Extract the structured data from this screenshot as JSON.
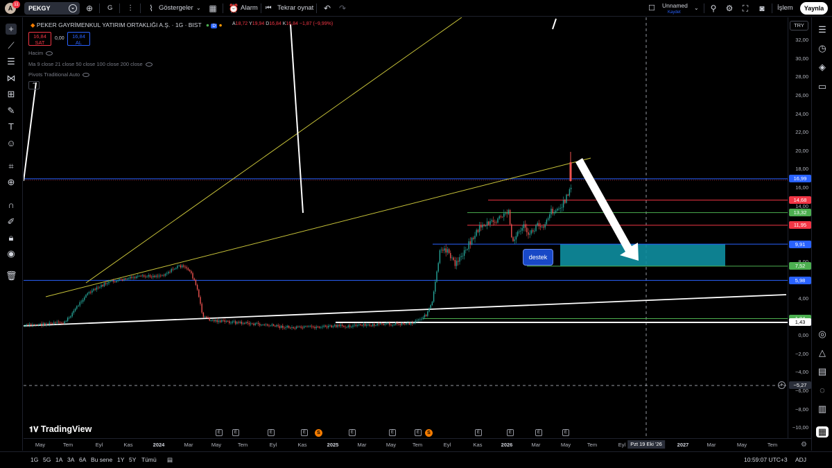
{
  "topbar": {
    "avatar_letter": "A",
    "notifications": "11",
    "symbol": "PEKGY",
    "interval": "G",
    "indicators": "Göstergeler",
    "alarm": "Alarm",
    "replay": "Tekrar oynat",
    "layout_name": "Unnamed",
    "save_label": "Kaydet",
    "trade": "İşlem",
    "publish": "Yaynla"
  },
  "legend": {
    "title": "PEKER GAYRİMENKUL YATIRIM ORTAKLIĞI A.Ş. · 1G · BIST",
    "o_key": "A",
    "o": "18,72",
    "h_key": "Y",
    "h": "19,94",
    "l_key": "D",
    "l": "16,84",
    "c_key": "K",
    "c": "16,84",
    "change": "−1,87 (−9,99%)",
    "sell_price": "16,84",
    "sell_label": "SAT",
    "spread": "0,00",
    "buy_price": "16,84",
    "buy_label": "AL",
    "ind_volume": "Hacim",
    "ind_ma": "Ma 9 close 21 close 50 close 100 close 200 close",
    "ind_pivots": "Pivots Traditional Auto"
  },
  "currency": "TRY",
  "annotation": "destek",
  "watermark": "TradingView",
  "chart_data": {
    "type": "candlestick",
    "series": [
      {
        "name": "PEKGY"
      }
    ],
    "y_range": [
      -10,
      33
    ],
    "price_ticks": [
      "32,00",
      "30,00",
      "28,00",
      "26,00",
      "24,00",
      "22,00",
      "20,00",
      "18,00",
      "16,00",
      "14,00",
      "12,00",
      "10,00",
      "8,00",
      "6,00",
      "4,00",
      "2,00",
      "0,00",
      "−2,00",
      "−4,00",
      "−6,00",
      "−8,00",
      "−10,00"
    ],
    "time_ticks": [
      {
        "label": "May",
        "year": false
      },
      {
        "label": "Tem",
        "year": false
      },
      {
        "label": "Eyl",
        "year": false
      },
      {
        "label": "Kas",
        "year": false
      },
      {
        "label": "2024",
        "year": true
      },
      {
        "label": "Mar",
        "year": false
      },
      {
        "label": "May",
        "year": false
      },
      {
        "label": "Tem",
        "year": false
      },
      {
        "label": "Eyl",
        "year": false
      },
      {
        "label": "Kas",
        "year": false
      },
      {
        "label": "2025",
        "year": true
      },
      {
        "label": "Mar",
        "year": false
      },
      {
        "label": "May",
        "year": false
      },
      {
        "label": "Tem",
        "year": false
      },
      {
        "label": "Eyl",
        "year": false
      },
      {
        "label": "Kas",
        "year": false
      },
      {
        "label": "2026",
        "year": true
      },
      {
        "label": "Mar",
        "year": false
      },
      {
        "label": "May",
        "year": false
      },
      {
        "label": "Tem",
        "year": false
      },
      {
        "label": "Eyl",
        "year": false
      },
      {
        "label": "2027",
        "year": true
      },
      {
        "label": "Mar",
        "year": false
      },
      {
        "label": "May",
        "year": false
      },
      {
        "label": "Tem",
        "year": false
      }
    ],
    "crosshair_date": "Pzt 19 Eki '26",
    "crosshair_price": "−5,27",
    "horizontal_levels": [
      {
        "value": 16.99,
        "label": "16,99",
        "color": "#2962ff"
      },
      {
        "value": 14.68,
        "label": "14,68",
        "color": "#f23645"
      },
      {
        "value": 13.32,
        "label": "13,32",
        "color": "#4caf50"
      },
      {
        "value": 11.95,
        "label": "11,95",
        "color": "#f23645"
      },
      {
        "value": 9.91,
        "label": "9,91",
        "color": "#2962ff"
      },
      {
        "value": 7.52,
        "label": "7,52",
        "color": "#4caf50"
      },
      {
        "value": 5.98,
        "label": "5,98",
        "color": "#2962ff"
      },
      {
        "value": 1.84,
        "label": "1,84",
        "color": "#4caf50"
      },
      {
        "value": 1.43,
        "label": "1,43",
        "color": "#ffffff"
      }
    ],
    "support_zone": [
      7.52,
      9.91
    ],
    "last_price": 16.84,
    "events": [
      "E",
      "E",
      "E",
      "E",
      "S",
      "E",
      "E",
      "E",
      "S",
      "E",
      "E",
      "E",
      "E"
    ]
  },
  "bottombar": {
    "ranges": [
      "1G",
      "5G",
      "1A",
      "3A",
      "6A",
      "Bu sene",
      "1Y",
      "5Y",
      "Tümü"
    ],
    "clock": "10:59:07 UTC+3",
    "adj": "ADJ"
  },
  "colors": {
    "background": "#000000",
    "up": "#26a69a",
    "down": "#ef5350",
    "trend_yellow": "#c9c43a",
    "zone": "#0e8ea0"
  }
}
